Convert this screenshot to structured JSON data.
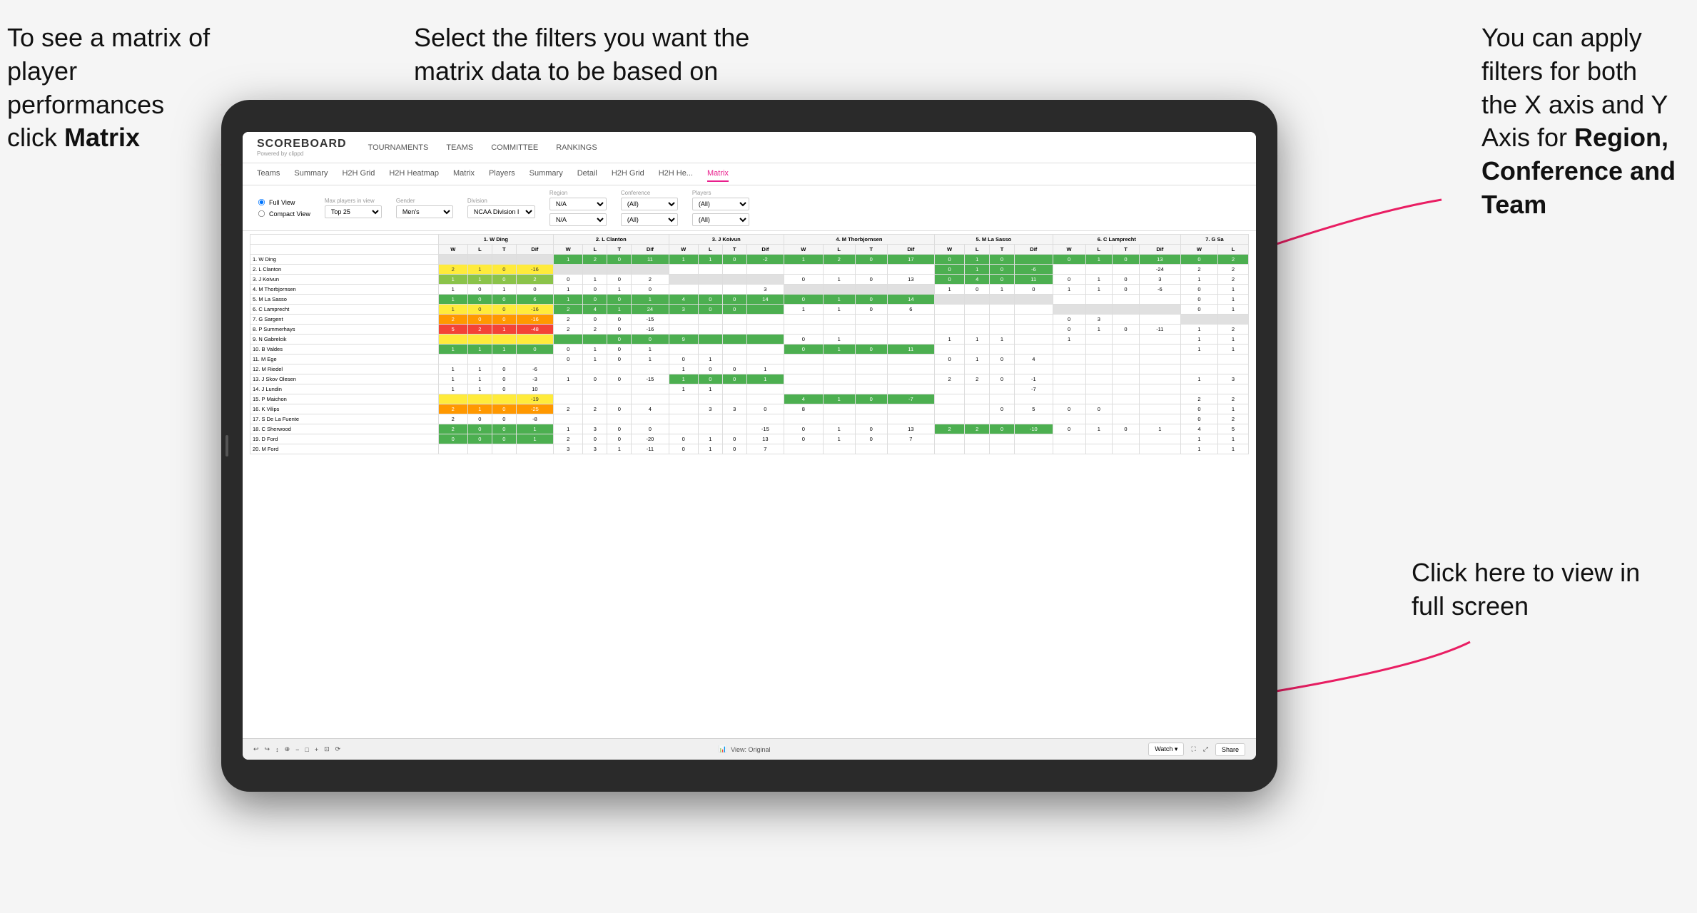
{
  "annotations": {
    "top_left": "To see a matrix of player performances click Matrix",
    "top_left_bold": "Matrix",
    "top_center": "Select the filters you want the matrix data to be based on",
    "top_right_line1": "You  can apply filters for both the X axis and Y Axis for ",
    "top_right_bold": "Region, Conference and Team",
    "bottom_right": "Click here to view in full screen"
  },
  "nav": {
    "logo": "SCOREBOARD",
    "logo_sub": "Powered by clippd",
    "items": [
      "TOURNAMENTS",
      "TEAMS",
      "COMMITTEE",
      "RANKINGS"
    ]
  },
  "tabs": {
    "player_tabs": [
      "Teams",
      "Summary",
      "H2H Grid",
      "H2H Heatmap",
      "Matrix",
      "Players",
      "Summary",
      "Detail",
      "H2H Grid",
      "H2H He...",
      "Matrix"
    ],
    "active": "Matrix"
  },
  "filters": {
    "view_full": "Full View",
    "view_compact": "Compact View",
    "max_players_label": "Max players in view",
    "max_players_value": "Top 25",
    "gender_label": "Gender",
    "gender_value": "Men's",
    "division_label": "Division",
    "division_value": "NCAA Division I",
    "region_label": "Region",
    "region_value": "N/A",
    "conference_label": "Conference",
    "conference_value": "(All)",
    "players_label": "Players",
    "players_value": "(All)"
  },
  "column_headers": [
    "1. W Ding",
    "2. L Clanton",
    "3. J Koivun",
    "4. M Thorbjornsen",
    "5. M La Sasso",
    "6. C Lamprecht",
    "7. G Sa"
  ],
  "sub_headers": [
    "W",
    "L",
    "T",
    "Dif"
  ],
  "players": [
    "1. W Ding",
    "2. L Clanton",
    "3. J Koivun",
    "4. M Thorbjornsen",
    "5. M La Sasso",
    "6. C Lamprecht",
    "7. G Sargent",
    "8. P Summerhays",
    "9. N Gabrelcik",
    "10. B Valdes",
    "11. M Ege",
    "12. M Riedel",
    "13. J Skov Olesen",
    "14. J Lundin",
    "15. P Maichon",
    "16. K Vilips",
    "17. S De La Fuente",
    "18. C Sherwood",
    "19. D Ford",
    "20. M Ford"
  ],
  "toolbar": {
    "view_label": "View: Original",
    "watch_label": "Watch ▾",
    "share_label": "Share"
  }
}
